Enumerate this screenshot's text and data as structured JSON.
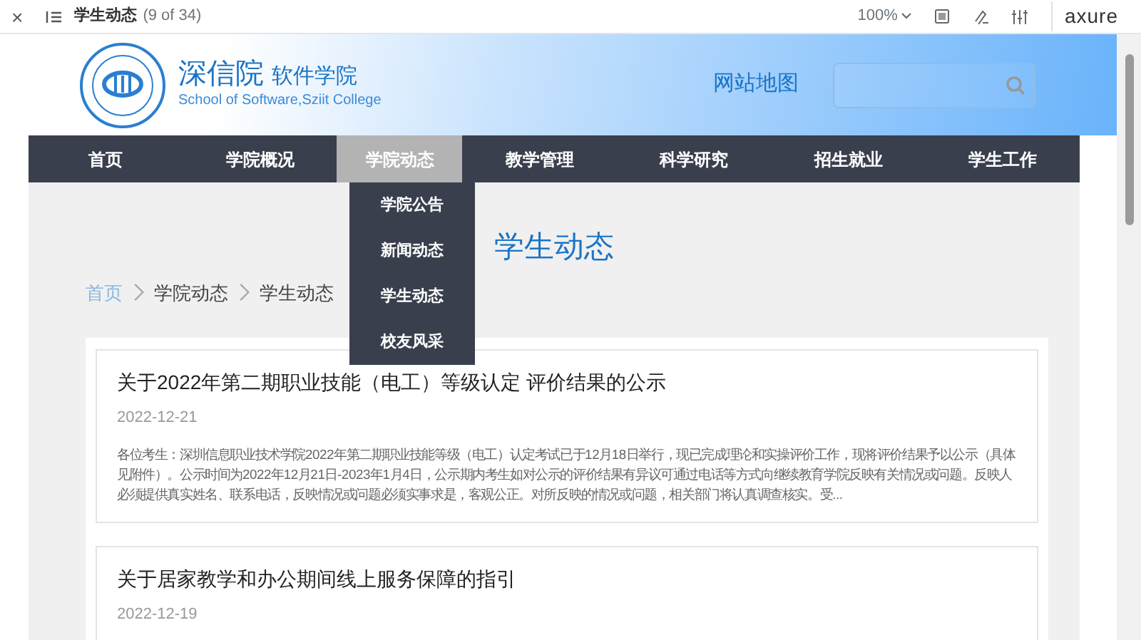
{
  "viewer_bar": {
    "close": "×",
    "page_title": "学生动态",
    "page_count": "(9 of 34)",
    "zoom": "100%",
    "brand": "axure"
  },
  "header": {
    "school_name": "深信院",
    "department": "软件学院",
    "english_name": "School of Software,Sziit College",
    "sitemap_link": "网站地图"
  },
  "nav": [
    {
      "label": "首页",
      "selected": false
    },
    {
      "label": "学院概况",
      "selected": false
    },
    {
      "label": "学院动态",
      "selected": true
    },
    {
      "label": "教学管理",
      "selected": false
    },
    {
      "label": "科学研究",
      "selected": false
    },
    {
      "label": "招生就业",
      "selected": false
    },
    {
      "label": "学生工作",
      "selected": false
    }
  ],
  "dropdown": [
    "学院公告",
    "新闻动态",
    "学生动态",
    "校友风采"
  ],
  "page_heading": "学生动态",
  "breadcrumb": [
    {
      "label": "首页",
      "link": true
    },
    {
      "label": "学院动态",
      "link": false
    },
    {
      "label": "学生动态",
      "link": false
    }
  ],
  "articles": [
    {
      "title": "关于2022年第二期职业技能（电工）等级认定 评价结果的公示",
      "date": "2022-12-21",
      "summary": "各位考生：深圳信息职业技术学院2022年第二期职业技能等级（电工）认定考试已于12月18日举行，现已完成理论和实操评价工作，现将评价结果予以公示（具体见附件）。公示时间为2022年12月21日-2023年1月4日，公示期内考生如对公示的评价结果有异议可通过电话等方式向继续教育学院反映有关情况或问题。反映人必须提供真实姓名、联系电话，反映情况或问题必须实事求是，客观公正。对所反映的情况或问题，相关部门将认真调查核实。受..."
    },
    {
      "title": "关于居家教学和办公期间线上服务保障的指引",
      "date": "2022-12-19"
    }
  ]
}
